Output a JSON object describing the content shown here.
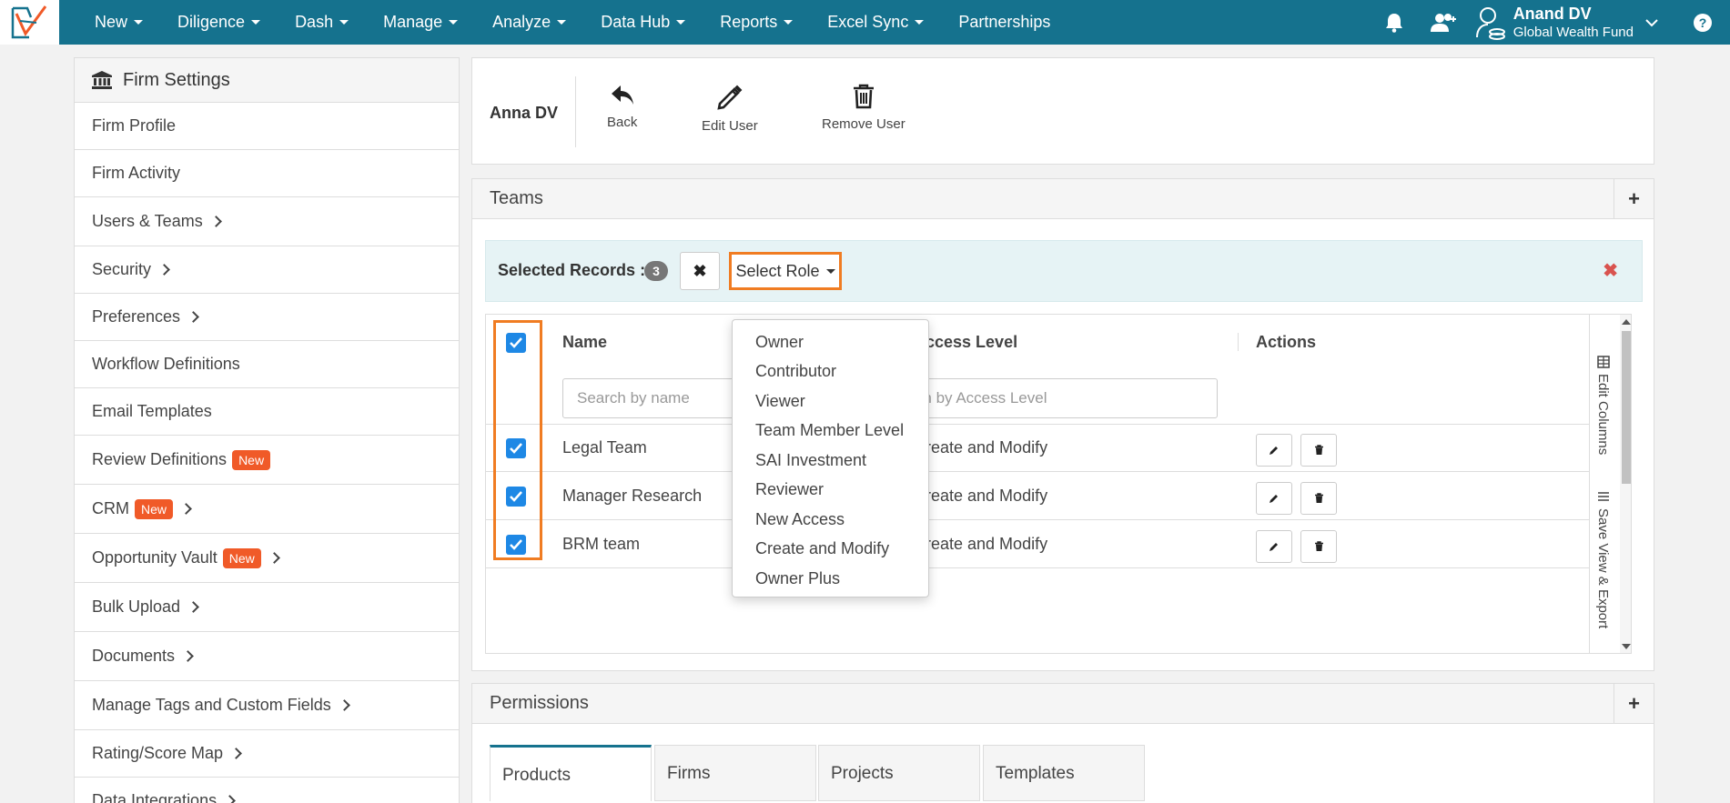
{
  "nav": {
    "items": [
      "New",
      "Diligence",
      "Dash",
      "Manage",
      "Analyze",
      "Data Hub",
      "Reports",
      "Excel Sync",
      "Partnerships"
    ],
    "user_name": "Anand DV",
    "user_org": "Global Wealth Fund"
  },
  "sidebar": {
    "title": "Firm Settings",
    "items": [
      {
        "label": "Firm Profile"
      },
      {
        "label": "Firm Activity"
      },
      {
        "label": "Users & Teams"
      },
      {
        "label": "Security"
      },
      {
        "label": "Preferences"
      },
      {
        "label": "Workflow Definitions"
      },
      {
        "label": "Email Templates"
      },
      {
        "label": "Review Definitions",
        "badge": "New"
      },
      {
        "label": "CRM",
        "badge": "New"
      },
      {
        "label": "Opportunity Vault",
        "badge": "New"
      },
      {
        "label": "Bulk Upload"
      },
      {
        "label": "Documents"
      },
      {
        "label": "Manage Tags and Custom Fields"
      },
      {
        "label": "Rating/Score Map"
      },
      {
        "label": "Data Integrations"
      }
    ]
  },
  "user_panel": {
    "name": "Anna DV",
    "back_label": "Back",
    "edit_label": "Edit User",
    "remove_label": "Remove User"
  },
  "teams": {
    "title": "Teams",
    "selected_label": "Selected Records :",
    "selected_count": "3",
    "select_role_label": "Select Role",
    "columns": {
      "name": "Name",
      "access": "Access Level",
      "actions": "Actions"
    },
    "search_name_placeholder": "Search by name",
    "search_access_placeholder": "Search by Access Level",
    "rows": [
      {
        "name": "Legal Team",
        "access": "Create and Modify"
      },
      {
        "name": "Manager Research",
        "access": "Create and Modify"
      },
      {
        "name": "BRM team",
        "access": "Create and Modify"
      }
    ],
    "edit_columns_label": "Edit Columns",
    "save_view_label": "Save View & Export"
  },
  "role_dropdown": {
    "options": [
      "Owner",
      "Contributor",
      "Viewer",
      "Team Member Level",
      "SAI Investment",
      "Reviewer",
      "New Access",
      "Create and Modify",
      "Owner Plus"
    ]
  },
  "permissions": {
    "title": "Permissions",
    "tabs": [
      "Products",
      "Firms",
      "Projects",
      "Templates"
    ]
  },
  "colors": {
    "nav_bg": "#15728e",
    "accent_orange": "#f07c22",
    "badge_new": "#f05a28",
    "checkbox": "#1e88e5"
  }
}
